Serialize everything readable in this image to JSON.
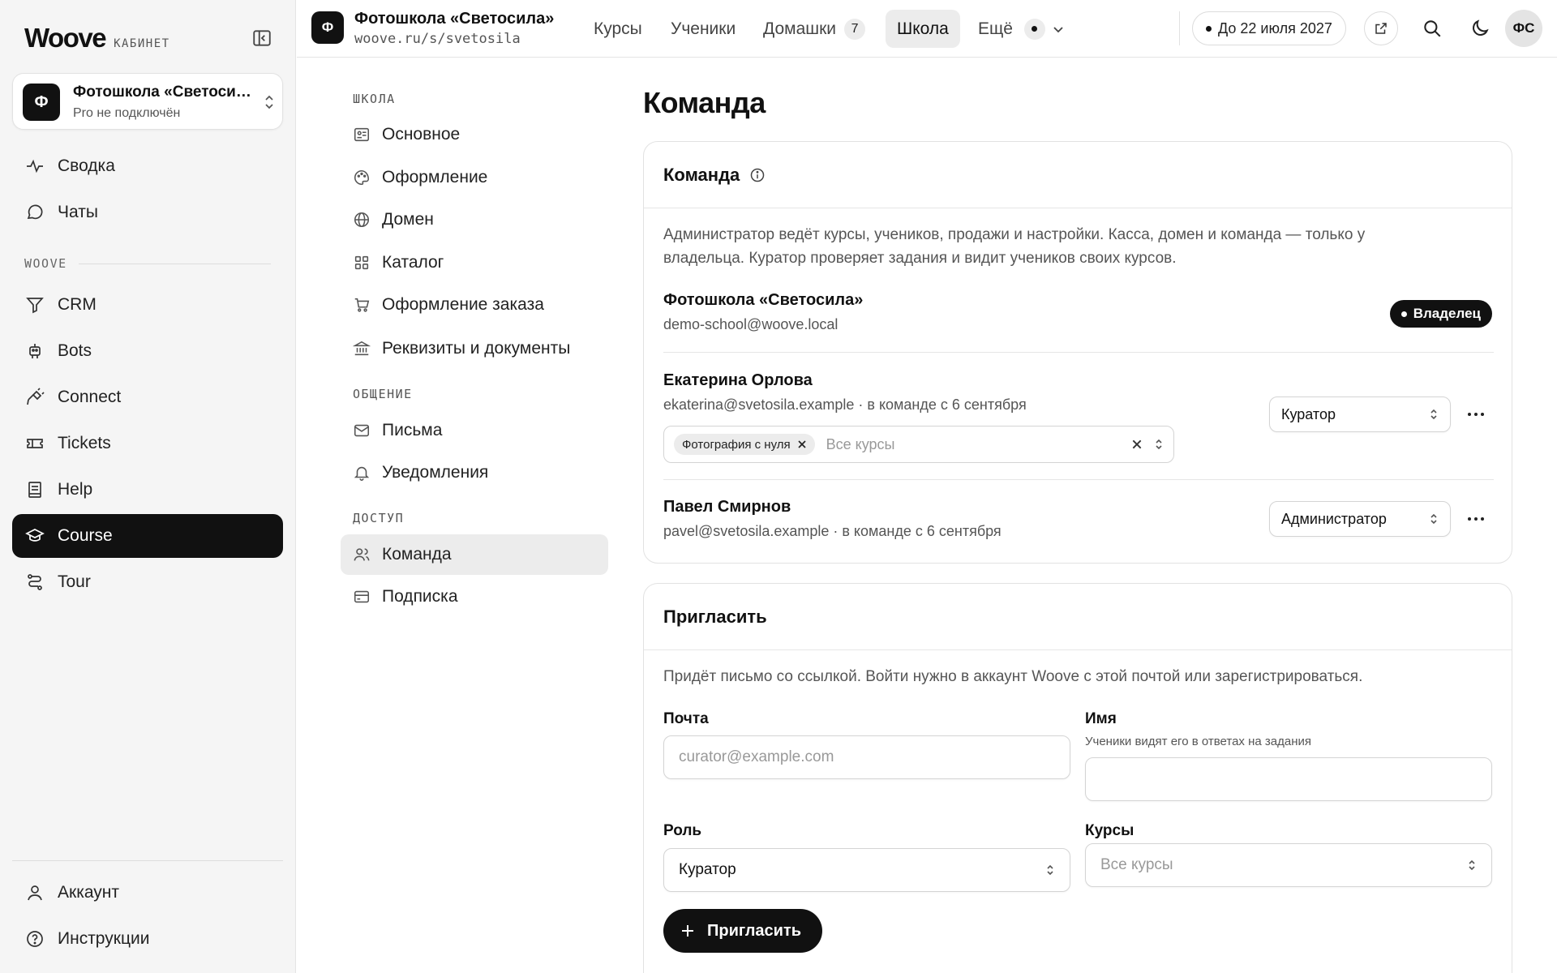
{
  "sidebar": {
    "logo": "Woove",
    "logo_sub": "КАБИНЕТ",
    "school": {
      "avatar": "Ф",
      "name": "Фотошкола «Светосила»",
      "plan": "Pro не подключён"
    },
    "items_top": [
      {
        "label": "Сводка",
        "icon": "pulse-icon"
      },
      {
        "label": "Чаты",
        "icon": "chat-icon"
      }
    ],
    "section_label": "WOOVE",
    "items_apps": [
      {
        "label": "CRM",
        "icon": "funnel-icon"
      },
      {
        "label": "Bots",
        "icon": "bot-icon"
      },
      {
        "label": "Connect",
        "icon": "plug-icon"
      },
      {
        "label": "Tickets",
        "icon": "ticket-icon"
      },
      {
        "label": "Help",
        "icon": "book-icon"
      },
      {
        "label": "Course",
        "icon": "graduation-cap-icon",
        "active": true
      },
      {
        "label": "Tour",
        "icon": "route-icon"
      }
    ],
    "items_bottom": [
      {
        "label": "Аккаунт",
        "icon": "user-icon"
      },
      {
        "label": "Инструкции",
        "icon": "help-circle-icon"
      }
    ]
  },
  "topbar": {
    "avatar": "Ф",
    "title": "Фотошкола «Светосила»",
    "url": "woove.ru/s/svetosila",
    "tabs": [
      "Курсы",
      "Ученики",
      "Домашки",
      "Школа",
      "Ещё"
    ],
    "homework_count": "7",
    "active_tab": "Школа",
    "deadline": "До 22 июля 2027",
    "user_initials": "ФС"
  },
  "settings_nav": {
    "sections": [
      {
        "title": "ШКОЛА",
        "items": [
          "Основное",
          "Оформление",
          "Домен",
          "Каталог",
          "Оформление заказа",
          "Реквизиты и документы"
        ]
      },
      {
        "title": "ОБЩЕНИЕ",
        "items": [
          "Письма",
          "Уведомления"
        ]
      },
      {
        "title": "ДОСТУП",
        "items": [
          "Команда",
          "Подписка"
        ]
      }
    ],
    "active": "Команда"
  },
  "main": {
    "title": "Команда",
    "team_card": {
      "title": "Команда",
      "description": "Администратор ведёт курсы, учеников, продажи и настройки. Касса, домен и команда — только у владельца. Куратор проверяет задания и видит учеников своих курсов.",
      "owner": {
        "name": "Фотошкола «Светосила»",
        "email": "demo-school@woove.local",
        "badge": "Владелец"
      },
      "members": [
        {
          "name": "Екатерина Орлова",
          "meta": "ekaterina@svetosila.example · в команде с 6 сентября",
          "role": "Куратор",
          "course_chip": "Фотография с нуля",
          "courses_placeholder": "Все курсы"
        },
        {
          "name": "Павел Смирнов",
          "meta": "pavel@svetosila.example · в команде с 6 сентября",
          "role": "Администратор"
        }
      ]
    },
    "invite_card": {
      "title": "Пригласить",
      "description": "Придёт письмо со ссылкой. Войти нужно в аккаунт Woove с этой почтой или зарегистрироваться.",
      "email_label": "Почта",
      "email_placeholder": "curator@example.com",
      "name_label": "Имя",
      "name_hint": "Ученики видят его в ответах на задания",
      "role_label": "Роль",
      "role_value": "Куратор",
      "courses_label": "Курсы",
      "courses_placeholder": "Все курсы",
      "submit_label": "Пригласить"
    }
  }
}
